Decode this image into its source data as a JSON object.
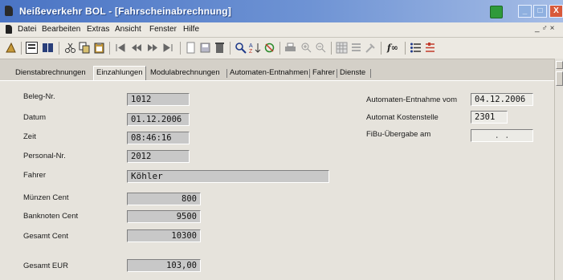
{
  "window": {
    "title": "Neißeverkehr BOL - [Fahrscheinabrechnung]",
    "min_glyph": "_",
    "max_glyph": "□",
    "close_glyph": "X"
  },
  "menu": {
    "items": [
      "Datei",
      "Bearbeiten",
      "Extras",
      "Ansicht",
      "Fenster",
      "Hilfe"
    ],
    "mdi_controls": "_ ♂ ×"
  },
  "toolbar": {
    "fx_label": "f∞",
    "accent_colors": {
      "find": "#1f3a8a",
      "filter": "#c23a2a",
      "book": "#2a3f7a"
    }
  },
  "tabs": [
    "Dienstabrechnungen",
    "Einzahlungen",
    "Modulabrechnungen",
    "Automaten-Entnahmen",
    "Fahrer",
    "Dienste"
  ],
  "active_tab": "Einzahlungen",
  "form": {
    "beleg_nr": {
      "label": "Beleg-Nr.",
      "value": "1012"
    },
    "datum": {
      "label": "Datum",
      "value": "01.12.2006"
    },
    "zeit": {
      "label": "Zeit",
      "value": "08:46:16"
    },
    "personal_nr": {
      "label": "Personal-Nr.",
      "value": "2012"
    },
    "fahrer": {
      "label": "Fahrer",
      "value": "Köhler"
    },
    "muenzen_cent": {
      "label": "Münzen Cent",
      "value": "800"
    },
    "banknoten_cent": {
      "label": "Banknoten Cent",
      "value": "9500"
    },
    "gesamt_cent": {
      "label": "Gesamt Cent",
      "value": "10300"
    },
    "gesamt_eur": {
      "label": "Gesamt EUR",
      "value": "103,00"
    },
    "automaten_entnahme_vom": {
      "label": "Automaten-Entnahme vom",
      "value": "04.12.2006"
    },
    "automat_kostenstelle": {
      "label": "Automat Kostenstelle",
      "value": "2301"
    },
    "fibu_uebergabe_am": {
      "label": "FiBu-Übergabe am",
      "value": ". ."
    }
  }
}
